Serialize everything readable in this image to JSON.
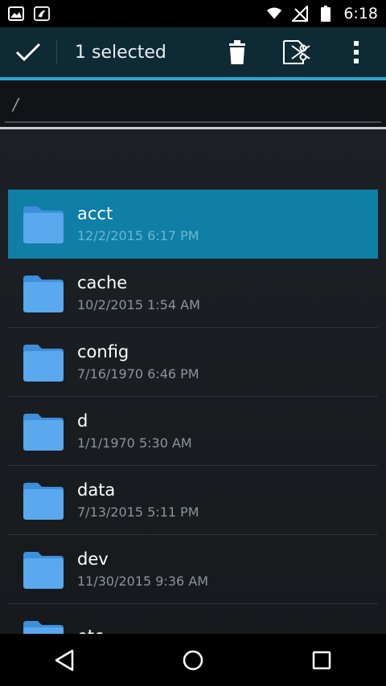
{
  "status_bar": {
    "time": "6:18",
    "left_icons": [
      "gallery-icon",
      "saavn-icon"
    ],
    "right_icons": [
      "wifi-icon",
      "no-signal-icon",
      "battery-icon"
    ]
  },
  "action_bar": {
    "title": "1 selected",
    "actions": [
      "done-check-icon",
      "delete-icon",
      "cut-icon",
      "overflow-menu-icon"
    ]
  },
  "path": {
    "value": "/"
  },
  "files": [
    {
      "name": "acct",
      "date": "12/2/2015 6:17 PM",
      "selected": true
    },
    {
      "name": "cache",
      "date": "10/2/2015 1:54 AM",
      "selected": false
    },
    {
      "name": "config",
      "date": "7/16/1970 6:46 PM",
      "selected": false
    },
    {
      "name": "d",
      "date": "1/1/1970 5:30 AM",
      "selected": false
    },
    {
      "name": "data",
      "date": "7/13/2015 5:11 PM",
      "selected": false
    },
    {
      "name": "dev",
      "date": "11/30/2015 9:36 AM",
      "selected": false
    },
    {
      "name": "etc",
      "date": "",
      "selected": false
    }
  ],
  "nav_bar": {
    "buttons": [
      "back-icon",
      "home-icon",
      "recents-icon"
    ]
  },
  "colors": {
    "accent": "#2aa9d8",
    "selected_row": "#0f7fa5",
    "folder": "#4a9ee8",
    "action_bar": "#0e2a35"
  }
}
